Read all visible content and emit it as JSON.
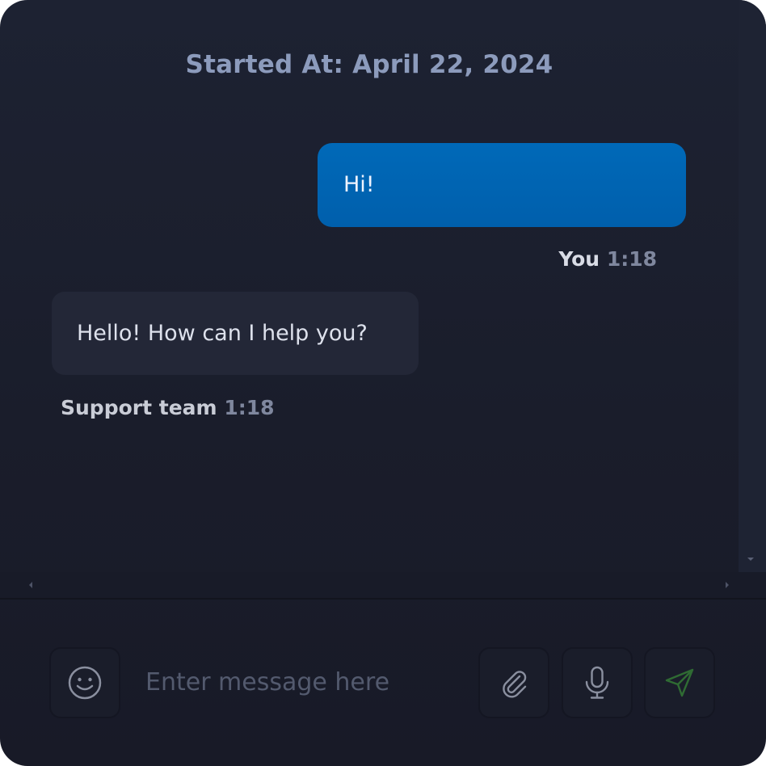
{
  "chat": {
    "started_label": "Started At: April 22, 2024",
    "messages": [
      {
        "text": "Hi!",
        "sender": "You",
        "time": "1:18",
        "direction": "outgoing"
      },
      {
        "text": "Hello! How can I help you?",
        "sender": "Support team",
        "time": "1:18",
        "direction": "incoming"
      }
    ]
  },
  "composer": {
    "placeholder": "Enter message here",
    "value": "",
    "icons": {
      "emoji": "smiley-icon",
      "attach": "paperclip-icon",
      "mic": "microphone-icon",
      "send": "send-icon"
    }
  },
  "colors": {
    "background": "#1c2030",
    "outgoing_bubble": "#0066b3",
    "incoming_bubble": "#232737",
    "send_icon": "#2f6b33",
    "started_label": "#8c9bbc"
  }
}
